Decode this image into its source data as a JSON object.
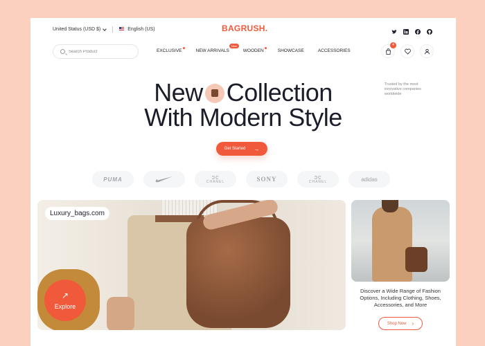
{
  "topbar": {
    "currency": "United Status (USD $)",
    "language": "English (US)",
    "logo": "BAGRUSH.",
    "social_icons": [
      "twitter-icon",
      "linkedin-icon",
      "facebook-icon",
      "github-icon"
    ]
  },
  "nav": {
    "search_placeholder": "Search Product",
    "items": [
      {
        "label": "EXCLUSIVE",
        "badge": "dot"
      },
      {
        "label": "NEW ARRIVALS",
        "badge": "New"
      },
      {
        "label": "WOODEN",
        "badge": "dot"
      },
      {
        "label": "SHOWCASE",
        "badge": ""
      },
      {
        "label": "ACCESSORIES",
        "badge": ""
      }
    ],
    "cart_count": "4",
    "icons": [
      "cart-icon",
      "heart-icon",
      "user-icon"
    ]
  },
  "hero": {
    "title_word1": "New",
    "title_word2": "Collection",
    "title_line2": "With Modern Style",
    "trusted_text": "Trusted by the most innovative companies worldwide",
    "cta_label": "Get Started"
  },
  "brands": [
    {
      "name": "PUMA"
    },
    {
      "name": "Nike"
    },
    {
      "name": "CHANEL"
    },
    {
      "name": "SONY"
    },
    {
      "name": "CHANEL"
    },
    {
      "name": "adidas"
    }
  ],
  "main_card": {
    "tag": "Luxury_bags.com",
    "explore_label": "Explore"
  },
  "side_card": {
    "text": "Discover a Wide Range of Fashion Options, Including Clothing, Shoes, Accessories, and More",
    "button_label": "Shop Now"
  },
  "colors": {
    "accent": "#f05a3b",
    "background": "#fbd0bf",
    "text": "#1c1d2b"
  }
}
